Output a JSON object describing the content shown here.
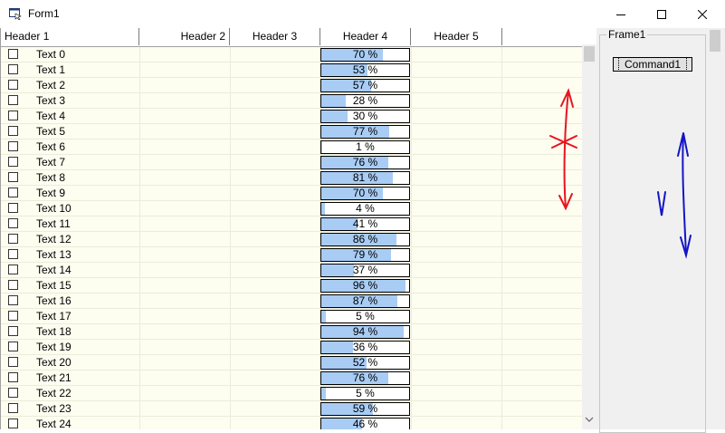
{
  "window": {
    "title": "Form1"
  },
  "listview": {
    "headers": [
      "Header 1",
      "Header 2",
      "Header 3",
      "Header 4",
      "Header 5"
    ],
    "rows": [
      {
        "label": "Text 0",
        "checked": false,
        "progress": "70 %",
        "pct": 70
      },
      {
        "label": "Text 1",
        "checked": false,
        "progress": "53 %",
        "pct": 53
      },
      {
        "label": "Text 2",
        "checked": false,
        "progress": "57 %",
        "pct": 57
      },
      {
        "label": "Text 3",
        "checked": false,
        "progress": "28 %",
        "pct": 28
      },
      {
        "label": "Text 4",
        "checked": false,
        "progress": "30 %",
        "pct": 30
      },
      {
        "label": "Text 5",
        "checked": false,
        "progress": "77 %",
        "pct": 77
      },
      {
        "label": "Text 6",
        "checked": false,
        "progress": "1 %",
        "pct": 1
      },
      {
        "label": "Text 7",
        "checked": false,
        "progress": "76 %",
        "pct": 76
      },
      {
        "label": "Text 8",
        "checked": false,
        "progress": "81 %",
        "pct": 81
      },
      {
        "label": "Text 9",
        "checked": false,
        "progress": "70 %",
        "pct": 70
      },
      {
        "label": "Text 10",
        "checked": false,
        "progress": "4 %",
        "pct": 4
      },
      {
        "label": "Text 11",
        "checked": false,
        "progress": "41 %",
        "pct": 41
      },
      {
        "label": "Text 12",
        "checked": false,
        "progress": "86 %",
        "pct": 86
      },
      {
        "label": "Text 13",
        "checked": false,
        "progress": "79 %",
        "pct": 79
      },
      {
        "label": "Text 14",
        "checked": false,
        "progress": "37 %",
        "pct": 37
      },
      {
        "label": "Text 15",
        "checked": false,
        "progress": "96 %",
        "pct": 96
      },
      {
        "label": "Text 16",
        "checked": false,
        "progress": "87 %",
        "pct": 87
      },
      {
        "label": "Text 17",
        "checked": false,
        "progress": "5 %",
        "pct": 5
      },
      {
        "label": "Text 18",
        "checked": false,
        "progress": "94 %",
        "pct": 94
      },
      {
        "label": "Text 19",
        "checked": false,
        "progress": "36 %",
        "pct": 36
      },
      {
        "label": "Text 20",
        "checked": false,
        "progress": "52 %",
        "pct": 52
      },
      {
        "label": "Text 21",
        "checked": false,
        "progress": "76 %",
        "pct": 76
      },
      {
        "label": "Text 22",
        "checked": false,
        "progress": "5 %",
        "pct": 5
      },
      {
        "label": "Text 23",
        "checked": false,
        "progress": "59 %",
        "pct": 59
      },
      {
        "label": "Text 24",
        "checked": false,
        "progress": "46 %",
        "pct": 46
      }
    ]
  },
  "frame": {
    "title": "Frame1",
    "button_label": "Command1"
  },
  "colors": {
    "row_bg": "#fdfdf0",
    "progress_fill": "#a8ccf4",
    "annotation_red": "#e8141e",
    "annotation_blue": "#1414c8"
  }
}
